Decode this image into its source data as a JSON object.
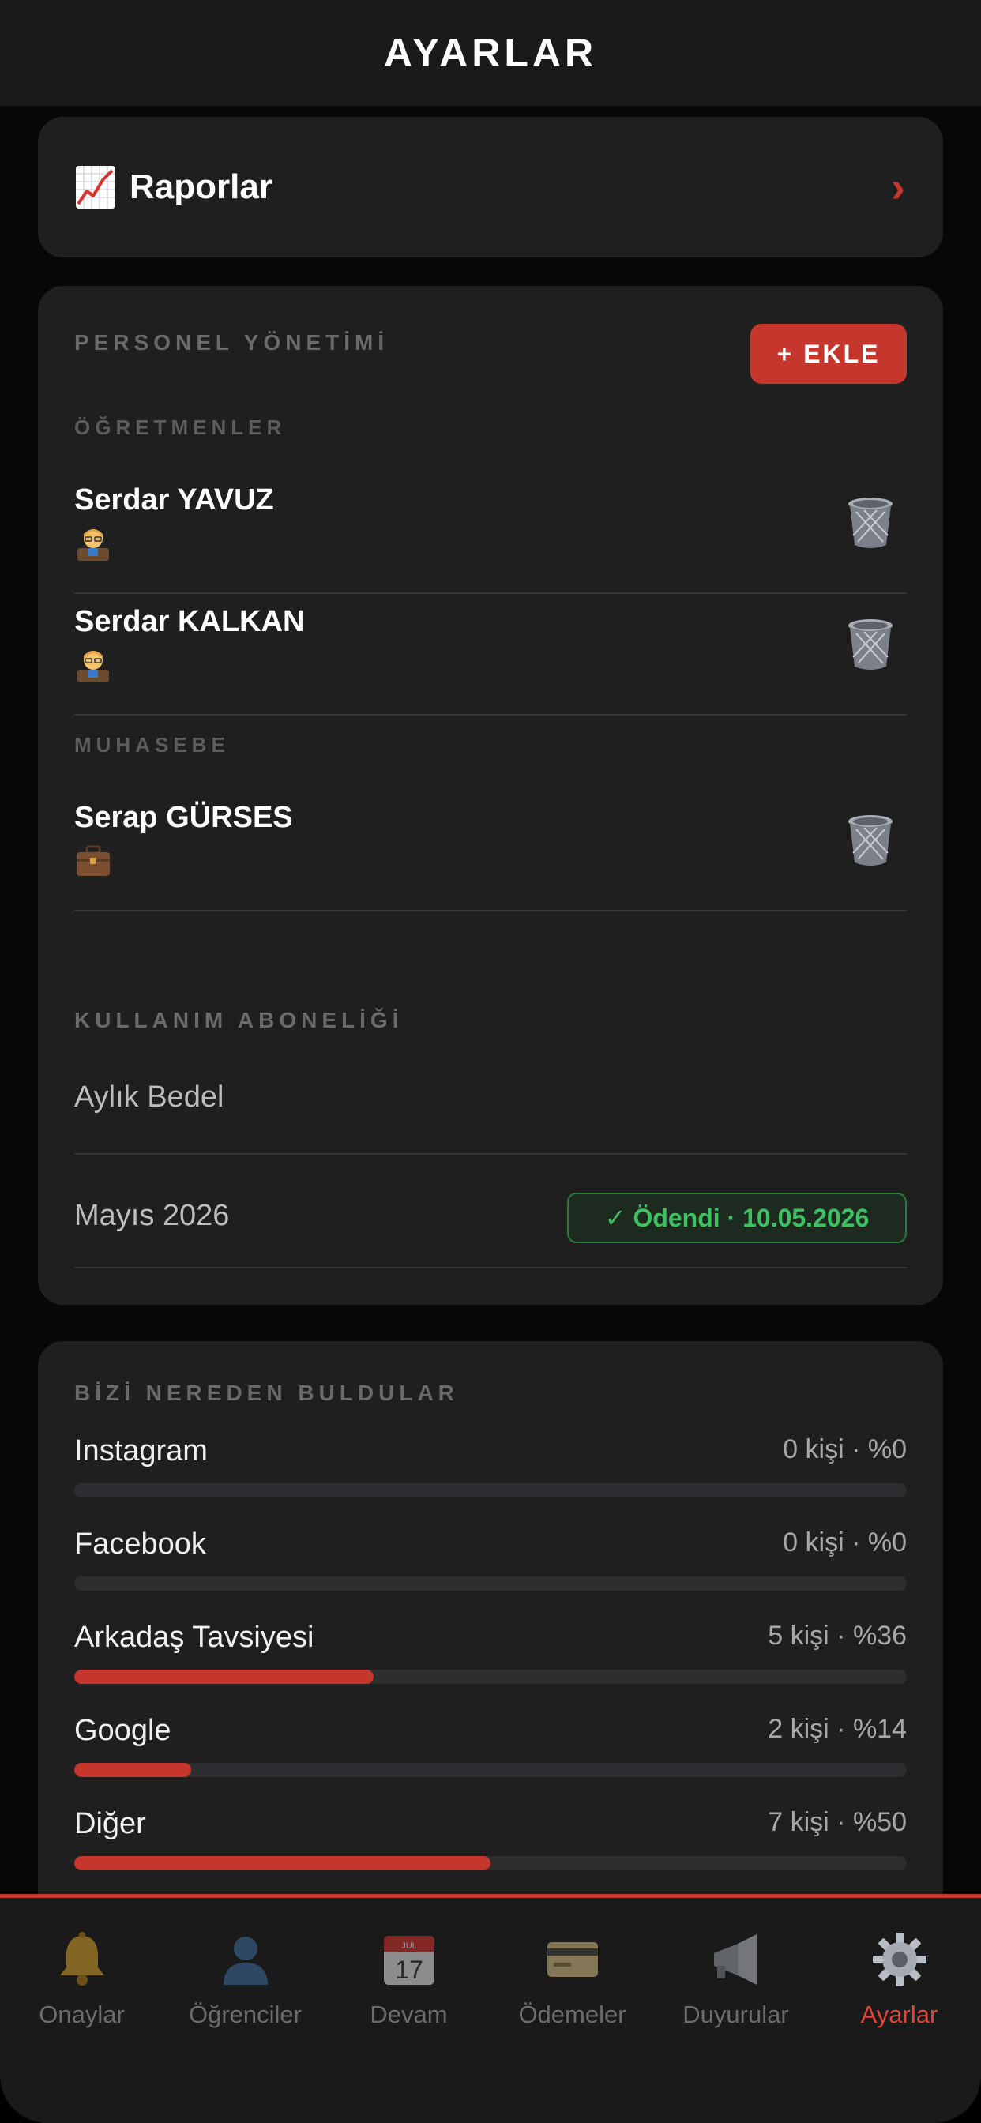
{
  "header": {
    "title": "AYARLAR"
  },
  "reports": {
    "label": "Raporlar",
    "icon": "chart-up-icon",
    "chevron": "›"
  },
  "staff": {
    "section_title": "PERSONEL YÖNETİMİ",
    "add_label": "+ EKLE",
    "teachers_title": "ÖĞRETMENLER",
    "teachers": [
      {
        "name": "Serdar YAVUZ",
        "icon": "teacher-icon"
      },
      {
        "name": "Serdar KALKAN",
        "icon": "teacher-icon"
      }
    ],
    "accounting_title": "MUHASEBE",
    "accounting": [
      {
        "name": "Serap GÜRSES",
        "icon": "briefcase-icon"
      }
    ]
  },
  "subscription": {
    "section_title": "KULLANIM ABONELİĞİ",
    "monthly_label": "Aylık Bedel",
    "month_label": "Mayıs 2026",
    "status": "✓ Ödendi · 10.05.2026",
    "status_color": "#3fc063"
  },
  "sources": {
    "section_title": "BİZİ NEREDEN BULDULAR",
    "items": [
      {
        "name": "Instagram",
        "value_text": "0 kişi · %0",
        "percent": 0
      },
      {
        "name": "Facebook",
        "value_text": "0 kişi · %0",
        "percent": 0
      },
      {
        "name": "Arkadaş Tavsiyesi",
        "value_text": "5 kişi · %36",
        "percent": 36
      },
      {
        "name": "Google",
        "value_text": "2 kişi · %14",
        "percent": 14
      },
      {
        "name": "Diğer",
        "value_text": "7 kişi · %50",
        "percent": 50
      }
    ],
    "bar_color": "#c5362d"
  },
  "tabs": [
    {
      "label": "Onaylar",
      "icon": "bell-icon"
    },
    {
      "label": "Öğrenciler",
      "icon": "person-icon"
    },
    {
      "label": "Devam",
      "icon": "calendar-icon",
      "calendar_month": "JUL",
      "calendar_day": "17"
    },
    {
      "label": "Ödemeler",
      "icon": "credit-card-icon"
    },
    {
      "label": "Duyurular",
      "icon": "megaphone-icon"
    },
    {
      "label": "Ayarlar",
      "icon": "gear-icon",
      "active": true
    }
  ],
  "accent_color": "#c5362d"
}
